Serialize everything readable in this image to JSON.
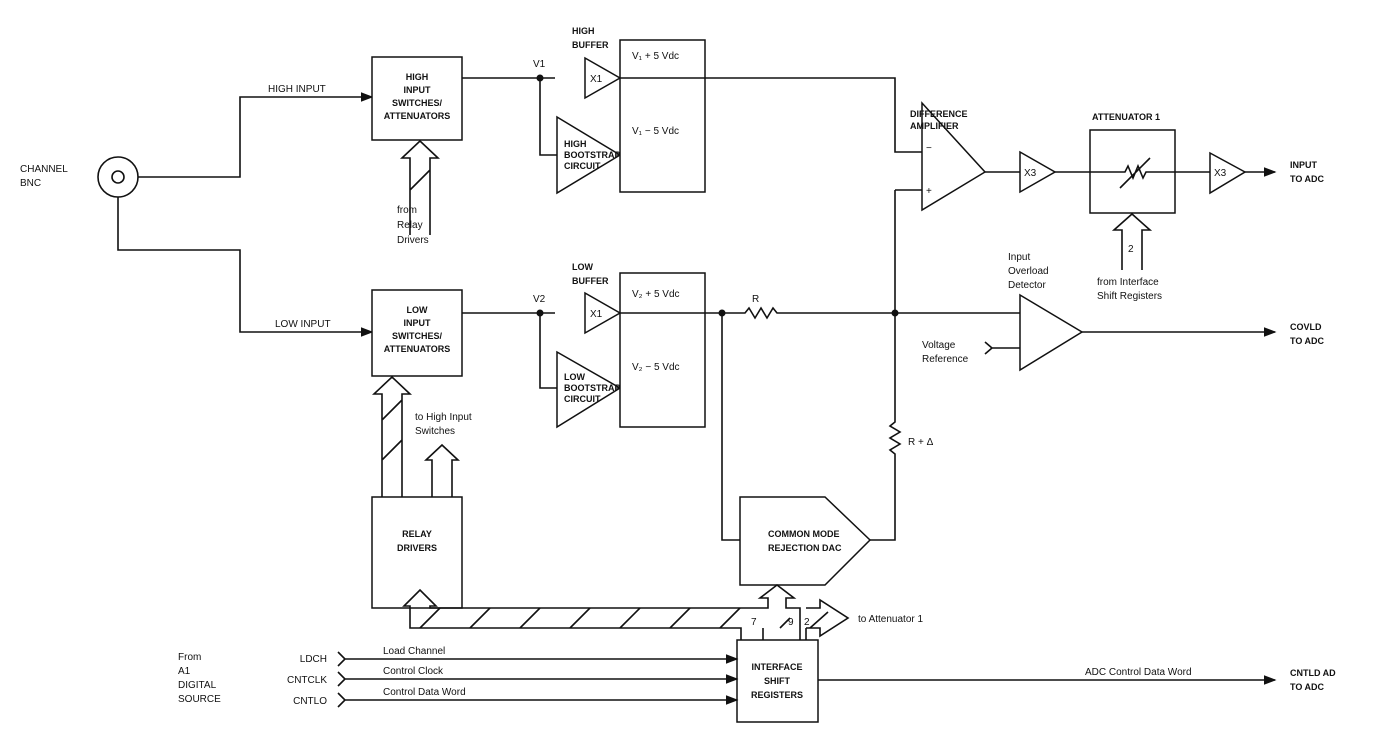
{
  "input": {
    "channel": [
      "CHANNEL",
      "BNC"
    ],
    "high_input": "HIGH INPUT",
    "low_input": "LOW INPUT"
  },
  "high_sw": [
    "HIGH",
    "INPUT",
    "SWITCHES/",
    "ATTENUATORS"
  ],
  "low_sw": [
    "LOW",
    "INPUT",
    "SWITCHES/",
    "ATTENUATORS"
  ],
  "from_relay": [
    "from",
    "Relay",
    "Drivers"
  ],
  "v1": "V1",
  "v2": "V2",
  "high_buffer": [
    "HIGH",
    "BUFFER"
  ],
  "low_buffer": [
    "LOW",
    "BUFFER"
  ],
  "x1": "X1",
  "x3": "X3",
  "high_boot": [
    "HIGH",
    "BOOTSTRAP",
    "CIRCUIT"
  ],
  "low_boot": [
    "LOW",
    "BOOTSTRAP",
    "CIRCUIT"
  ],
  "v1_plus": "V₁ + 5 Vdc",
  "v1_minus": "V₁ − 5 Vdc",
  "v2_plus": "V₂ + 5 Vdc",
  "v2_minus": "V₂ − 5 Vdc",
  "diff_amp": [
    "DIFFERENCE",
    "AMPLIFIER"
  ],
  "minus": "−",
  "plus": "+",
  "attenuator": "ATTENUATOR 1",
  "att_bits": "2",
  "from_isr": [
    "from Interface",
    "Shift Registers"
  ],
  "input_to_adc": [
    "INPUT",
    "TO ADC"
  ],
  "overload": [
    "Input",
    "Overload",
    "Detector"
  ],
  "vref": [
    "Voltage",
    "Reference"
  ],
  "covld": [
    "COVLD",
    "TO ADC"
  ],
  "r": "R",
  "r_delta": "R + Δ",
  "dac": [
    "COMMON MODE",
    "REJECTION DAC"
  ],
  "to_high_sw": [
    "to High Input",
    "Switches"
  ],
  "relay": [
    "RELAY",
    "DRIVERS"
  ],
  "bus": {
    "b7": "7",
    "b9": "9",
    "b2": "2",
    "to_att": "to Attenuator 1"
  },
  "isr": [
    "INTERFACE",
    "SHIFT",
    "REGISTERS"
  ],
  "source": [
    "From",
    "A1",
    "DIGITAL",
    "SOURCE"
  ],
  "signals": [
    {
      "name": "LDCH",
      "desc": "Load Channel"
    },
    {
      "name": "CNTCLK",
      "desc": "Control Clock"
    },
    {
      "name": "CNTLO",
      "desc": "Control Data Word"
    }
  ],
  "adc_word": "ADC Control Data Word",
  "cntld": [
    "CNTLD AD",
    "TO ADC"
  ]
}
